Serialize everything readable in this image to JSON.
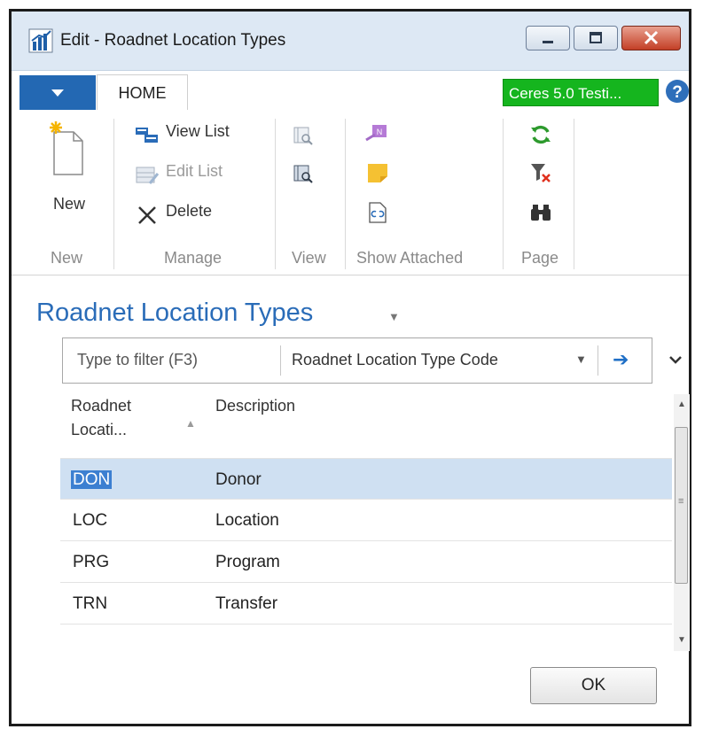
{
  "window": {
    "title": "Edit - Roadnet Location Types"
  },
  "ribbon": {
    "tab_home": "HOME",
    "company": "Ceres 5.0 Testi...",
    "groups": {
      "new": "New",
      "manage": "Manage",
      "view": "View",
      "show_attached": "Show Attached",
      "page": "Page"
    },
    "actions": {
      "new": "New",
      "view_list": "View List",
      "edit_list": "Edit List",
      "delete": "Delete"
    }
  },
  "page": {
    "title": "Roadnet Location Types"
  },
  "filter": {
    "placeholder": "Type to filter (F3)",
    "field": "Roadnet Location Type Code"
  },
  "table": {
    "columns": [
      {
        "label_line1": "Roadnet",
        "label_line2": "Locati..."
      },
      {
        "label": "Description"
      }
    ],
    "rows": [
      {
        "code": "DON",
        "description": "Donor"
      },
      {
        "code": "LOC",
        "description": "Location"
      },
      {
        "code": "PRG",
        "description": "Program"
      },
      {
        "code": "TRN",
        "description": "Transfer"
      }
    ]
  },
  "buttons": {
    "ok": "OK"
  },
  "colors": {
    "accent": "#2a6cb8",
    "company_badge": "#15b51e",
    "selection": "#cfe0f2"
  },
  "icons": [
    "app-chart-icon",
    "minimize-icon",
    "maximize-icon",
    "close-icon",
    "file-menu-arrow-icon",
    "help-icon",
    "new-document-icon",
    "view-list-icon",
    "edit-list-icon",
    "delete-x-icon",
    "view-icon",
    "view-details-icon",
    "onenote-icon",
    "notes-icon",
    "links-icon",
    "refresh-icon",
    "clear-filter-icon",
    "find-binoculars-icon",
    "filter-go-arrow-icon",
    "collapse-chevron-icon"
  ]
}
